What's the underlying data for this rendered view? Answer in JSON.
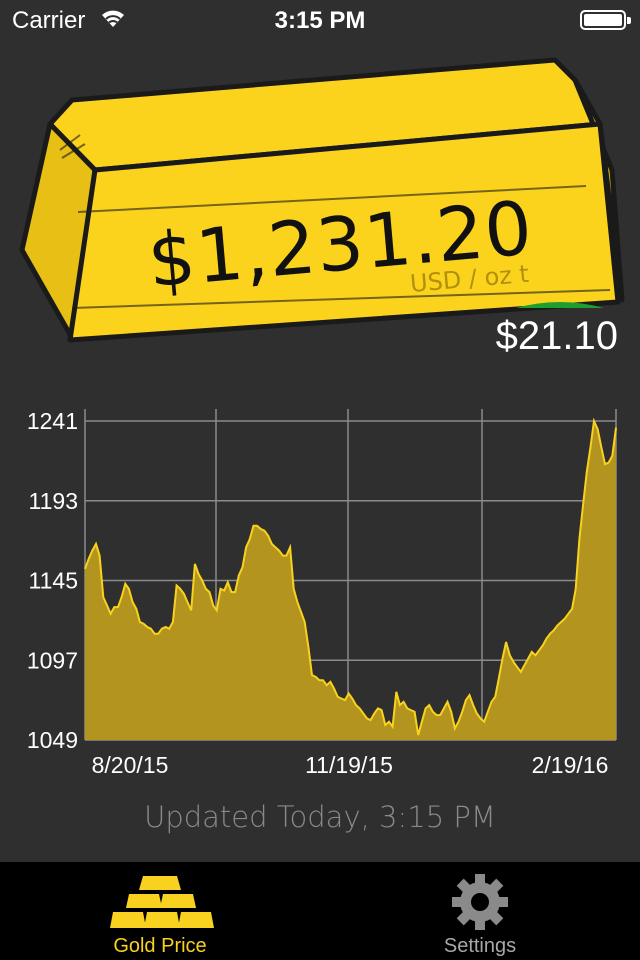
{
  "status_bar": {
    "carrier": "Carrier",
    "time": "3:15 PM"
  },
  "price": {
    "value": "$1,231.20",
    "unit": "USD / oz t",
    "change": "$21.10",
    "change_direction": "up",
    "change_color": "#1e9e2c"
  },
  "colors": {
    "gold": "#fcd31c",
    "chart_fill": "#b3941e",
    "chart_line": "#f8d21e",
    "background": "#2f2f2f"
  },
  "chart_data": {
    "type": "area",
    "x_tick_labels": [
      "8/20/15",
      "11/19/15",
      "2/19/16"
    ],
    "y_tick_labels": [
      "1241",
      "1193",
      "1145",
      "1097",
      "1049"
    ],
    "ylim": [
      1049,
      1241
    ],
    "grid": true,
    "series": [
      {
        "values": [
          1152,
          1158,
          1163,
          1167,
          1160,
          1135,
          1130,
          1125,
          1129,
          1129,
          1135,
          1143,
          1140,
          1132,
          1128,
          1120,
          1119,
          1117,
          1116,
          1113,
          1113,
          1116,
          1117,
          1116,
          1120,
          1142,
          1140,
          1137,
          1132,
          1127,
          1155,
          1149,
          1145,
          1140,
          1138,
          1130,
          1127,
          1140,
          1139,
          1144,
          1138,
          1138,
          1148,
          1153,
          1165,
          1170,
          1178,
          1178,
          1176,
          1175,
          1172,
          1167,
          1165,
          1163,
          1160,
          1160,
          1165,
          1140,
          1132,
          1126,
          1120,
          1105,
          1088,
          1087,
          1085,
          1085,
          1082,
          1084,
          1080,
          1075,
          1074,
          1073,
          1077,
          1074,
          1070,
          1068,
          1065,
          1062,
          1061,
          1065,
          1068,
          1067,
          1058,
          1060,
          1057,
          1078,
          1070,
          1072,
          1068,
          1067,
          1066,
          1052,
          1060,
          1068,
          1070,
          1066,
          1064,
          1064,
          1068,
          1072,
          1066,
          1056,
          1060,
          1066,
          1073,
          1076,
          1070,
          1065,
          1062,
          1060,
          1066,
          1072,
          1075,
          1086,
          1098,
          1108,
          1100,
          1096,
          1093,
          1090,
          1094,
          1098,
          1102,
          1100,
          1103,
          1106,
          1110,
          1113,
          1115,
          1118,
          1120,
          1122,
          1125,
          1128,
          1140,
          1170,
          1190,
          1210,
          1225,
          1241,
          1236,
          1225,
          1215,
          1216,
          1220,
          1237
        ]
      }
    ]
  },
  "updated_text": "Updated Today, 3:15 PM",
  "tabs": [
    {
      "label": "Gold Price",
      "icon": "gold-bars-icon",
      "selected": true
    },
    {
      "label": "Settings",
      "icon": "gear-icon",
      "selected": false
    }
  ]
}
